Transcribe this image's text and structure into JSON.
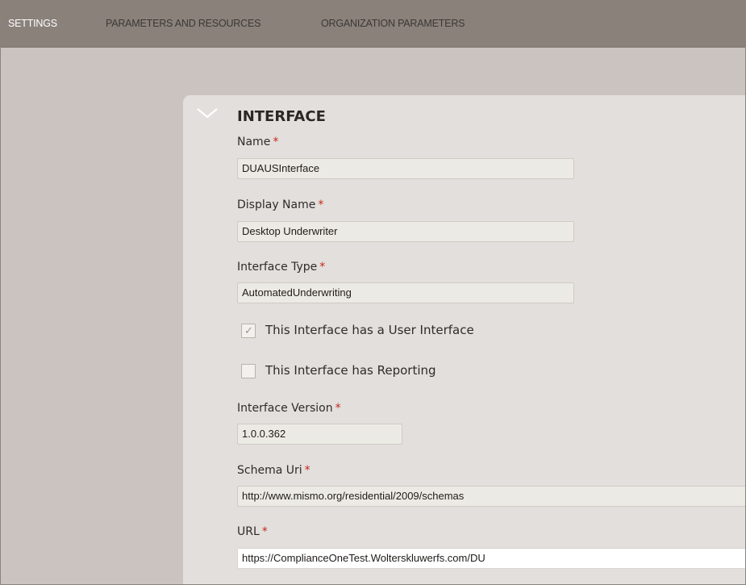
{
  "topnav": {
    "items": [
      {
        "label": "SETTINGS",
        "active": true
      },
      {
        "label": "PARAMETERS AND RESOURCES",
        "active": false
      },
      {
        "label": "ORGANIZATION PARAMETERS",
        "active": false
      }
    ]
  },
  "section": {
    "title": "INTERFACE",
    "collapse_icon": "chevron-down-icon"
  },
  "fields": {
    "name": {
      "label": "Name",
      "required_mark": "*",
      "value": "DUAUSInterface"
    },
    "display_name": {
      "label": "Display Name",
      "required_mark": "*",
      "value": "Desktop Underwriter"
    },
    "interface_type": {
      "label": "Interface Type",
      "required_mark": "*",
      "value": "AutomatedUnderwriting"
    },
    "interface_version": {
      "label": "Interface Version",
      "required_mark": "*",
      "value": "1.0.0.362"
    },
    "schema_uri": {
      "label": "Schema Uri",
      "required_mark": "*",
      "value": "http://www.mismo.org/residential/2009/schemas"
    },
    "url": {
      "label": "URL",
      "required_mark": "*",
      "value": "https://ComplianceOneTest.Wolterskluwerfs.com/DU"
    }
  },
  "checkboxes": {
    "user_interface": {
      "label": "This Interface has a User Interface",
      "checked": true,
      "tick": "✓"
    },
    "reporting": {
      "label": "This Interface has Reporting",
      "checked": false
    }
  },
  "colors": {
    "nav_bg": "#8a817b",
    "page_bg": "#cbc3bf",
    "panel_bg": "#e3dfdc",
    "required": "#c5281c"
  }
}
